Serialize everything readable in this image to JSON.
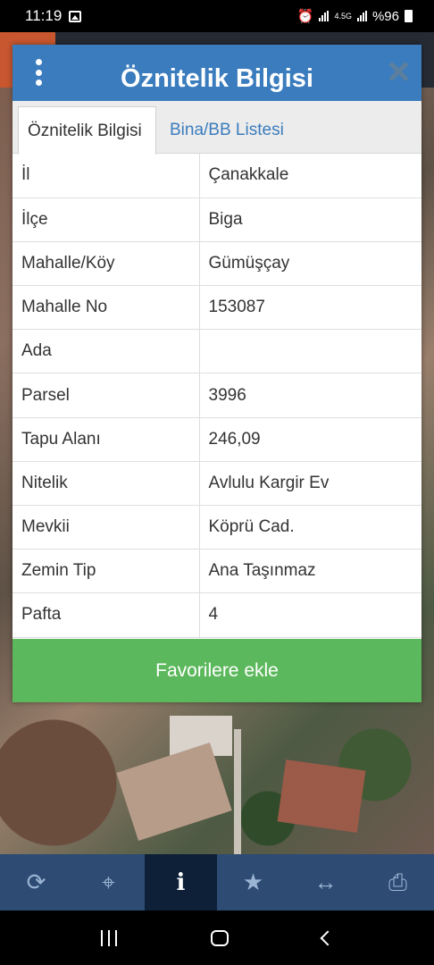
{
  "status_bar": {
    "time": "11:19",
    "network": "4.5G",
    "battery": "%96"
  },
  "dialog": {
    "title": "Öznitelik Bilgisi",
    "tabs": [
      {
        "label": "Öznitelik Bilgisi",
        "active": true
      },
      {
        "label": "Bina/BB Listesi",
        "active": false
      }
    ],
    "rows": [
      {
        "key": "İl",
        "value": "Çanakkale"
      },
      {
        "key": "İlçe",
        "value": "Biga"
      },
      {
        "key": "Mahalle/Köy",
        "value": "Gümüşçay"
      },
      {
        "key": "Mahalle No",
        "value": "153087"
      },
      {
        "key": "Ada",
        "value": ""
      },
      {
        "key": "Parsel",
        "value": "3996"
      },
      {
        "key": "Tapu Alanı",
        "value": "246,09"
      },
      {
        "key": "Nitelik",
        "value": "Avlulu Kargir Ev"
      },
      {
        "key": "Mevkii",
        "value": "Köprü Cad."
      },
      {
        "key": "Zemin Tip",
        "value": "Ana Taşınmaz"
      },
      {
        "key": "Pafta",
        "value": "4"
      }
    ],
    "favorite_button": "Favorilere ekle"
  },
  "toolbar": {
    "buttons": [
      {
        "icon": "refresh-icon",
        "glyph": "⟳"
      },
      {
        "icon": "locate-icon",
        "glyph": "⌖"
      },
      {
        "icon": "info-icon",
        "glyph": "i",
        "active": true
      },
      {
        "icon": "star-icon",
        "glyph": "★"
      },
      {
        "icon": "measure-icon",
        "glyph": "↔"
      },
      {
        "icon": "print-icon",
        "glyph": "⎙"
      }
    ]
  },
  "colors": {
    "header": "#3a7cbd",
    "favorite": "#5cb85c",
    "toolbar": "#2d4b73",
    "toolbar_active": "#0d2038"
  }
}
